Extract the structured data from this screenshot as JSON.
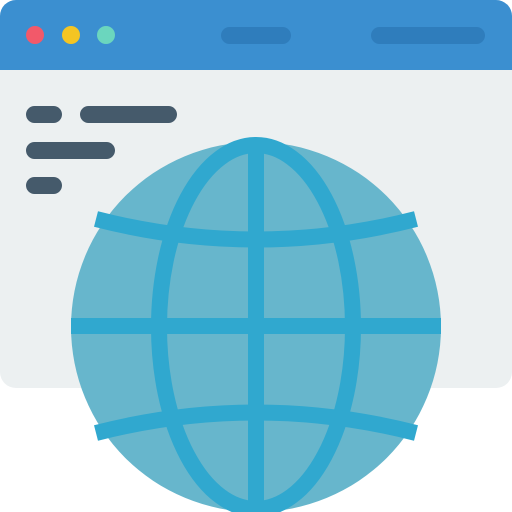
{
  "icon": {
    "name": "web-browser-globe-icon",
    "parts": {
      "window": "browser-window-icon",
      "globe": "globe-icon"
    }
  },
  "colors": {
    "titlebar": "#3B8FD0",
    "titlebar_pills": "#2F7DBC",
    "window_body": "#ECF0F1",
    "text_lines": "#455A6B",
    "close_dot": "#F2596A",
    "minimize_dot": "#F4C523",
    "maximize_dot": "#6BD6BE",
    "globe_fill": "#67B6CC",
    "globe_lines": "#30A8CF"
  }
}
